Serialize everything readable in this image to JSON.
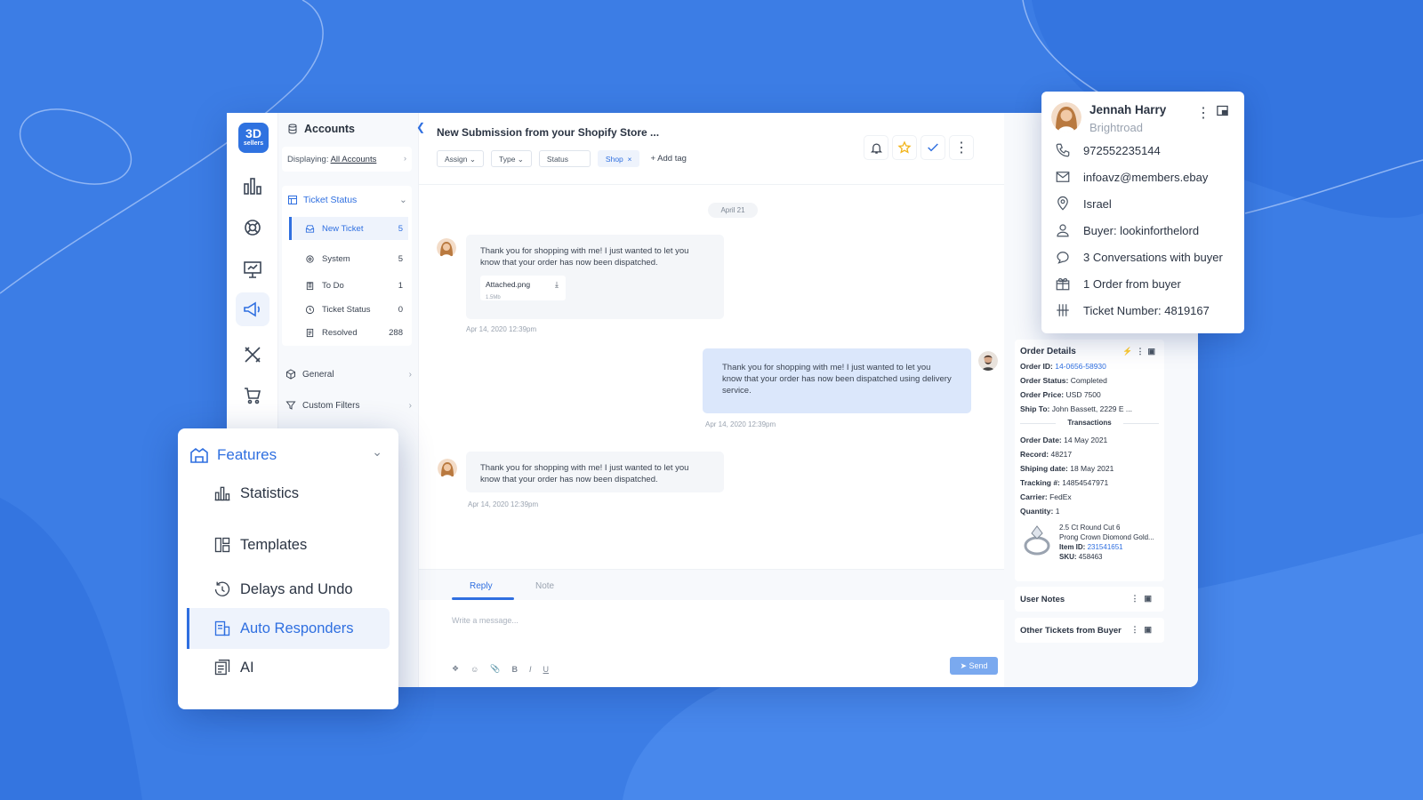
{
  "app": {
    "logo_line1": "3D",
    "logo_line2": "sellers"
  },
  "nav": {
    "accounts_label": "Accounts",
    "displaying_prefix": "Displaying:",
    "displaying_value": "All Accounts",
    "ticket_status_header": "Ticket Status",
    "ticket_items": [
      {
        "label": "New Ticket",
        "count": "5"
      },
      {
        "label": "System",
        "count": "5"
      },
      {
        "label": "To Do",
        "count": "1"
      },
      {
        "label": "Ticket Status",
        "count": "0"
      },
      {
        "label": "Resolved",
        "count": "288"
      }
    ],
    "general_label": "General",
    "custom_filters_label": "Custom Filters"
  },
  "ticket": {
    "title": "New Submission from your Shopify Store ...",
    "tags": {
      "assign": "Assign",
      "type": "Type",
      "status": "Status",
      "shop": "Shop",
      "add_tag": "+ Add tag"
    },
    "date_divider": "April 21",
    "messages": [
      {
        "text": "Thank you for shopping with me! I just wanted to let you know that your order has now been dispatched.",
        "time": "Apr 14, 2020 12:39pm",
        "attachment_name": "Attached.png",
        "attachment_size": "1.5Mb"
      },
      {
        "text": "Thank you for shopping with me! I just wanted to let you know that your order has now been dispatched using  delivery service.",
        "time": "Apr 14, 2020 12:39pm"
      },
      {
        "text": "Thank you for shopping with me! I just wanted to let you know that your order has now been dispatched.",
        "time": "Apr 14, 2020 12:39pm"
      }
    ]
  },
  "reply": {
    "tab_reply": "Reply",
    "tab_note": "Note",
    "placeholder": "Write a message...",
    "send_label": "Send",
    "tools": {
      "bold": "B",
      "italic": "I",
      "underline": "U"
    }
  },
  "customer": {
    "name": "Jennah Harry",
    "company": "Brightroad",
    "phone": "972552235144",
    "email": "infoavz@members.ebay",
    "location": "Israel",
    "buyer": "Buyer: lookinforthelord",
    "conversations": "3 Conversations with buyer",
    "orders": "1 Order from buyer",
    "ticket_number": "Ticket Number: 4819167"
  },
  "order": {
    "title": "Order Details",
    "order_id_label": "Order ID:",
    "order_id": "14-0656-58930",
    "status_label": "Order Status:",
    "status": "Completed",
    "price_label": "Order Price:",
    "price": "USD 7500",
    "ship_label": "Ship To:",
    "ship": "John Bassett, 2229 E ...",
    "transactions_label": "Transactions",
    "order_date_label": "Order Date:",
    "order_date": "14 May 2021",
    "record_label": "Record:",
    "record": "48217",
    "shipping_date_label": "Shiping date:",
    "shipping_date": "18 May 2021",
    "tracking_label": "Tracking #:",
    "tracking": "14854547971",
    "carrier_label": "Carrier:",
    "carrier": "FedEx",
    "quantity_label": "Quantity:",
    "quantity": "1",
    "product_line1": "2.5 Ct Round Cut 6",
    "product_line2": "Prong Crown Diomond Gold...",
    "item_id_label": "Item ID:",
    "item_id": "231541651",
    "sku_label": "SKU:",
    "sku": "458463",
    "user_notes": "User Notes",
    "other_tickets": "Other Tickets from Buyer"
  },
  "features": {
    "title": "Features",
    "items": [
      "Statistics",
      "Templates",
      "Delays and Undo",
      "Auto Responders",
      "AI"
    ]
  },
  "colors": {
    "background": "#3d7fe6",
    "accent": "#2f6fe0",
    "bubble_outgoing": "#dbe7fb"
  }
}
